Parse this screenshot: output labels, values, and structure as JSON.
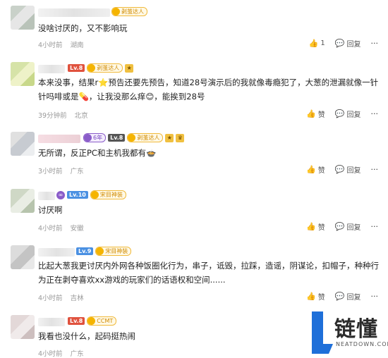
{
  "comments": [
    {
      "badge_medal": "剥茧达人",
      "text_lines": [
        "没啥讨厌的，又不影响玩"
      ],
      "time": "4小时前",
      "location": "湖南",
      "like_label": "1",
      "reply_label": "回复"
    },
    {
      "level": "Lv.8",
      "badge_medal": "剥茧达人",
      "text_lines": [
        "本来没事，结果r⭐预告还要先预告，知道28号演示后的我就像毒瘾犯了，大葱的泄漏就像一针",
        "针吗啡或是💊，让我没那么痒😊，能挨到28号"
      ],
      "time": "39分钟前",
      "location": "北京",
      "like_label": "赞",
      "reply_label": "回复"
    },
    {
      "years": "6年",
      "level": "Lv.8",
      "badge_medal": "剥茧达人",
      "text_lines": [
        "无所谓，反正PC和主机我都有🍲"
      ],
      "time": "3小时前",
      "location": "广东",
      "like_label": "赞",
      "reply_label": "回复"
    },
    {
      "level": "Lv.10",
      "badge_medal": "宋目神装",
      "text_lines": [
        "讨厌啊"
      ],
      "time": "4小时前",
      "location": "安徽",
      "like_label": "赞",
      "reply_label": "回复"
    },
    {
      "level": "Lv.9",
      "badge_medal": "宋目神装",
      "text_lines": [
        "比起大葱我更讨厌内外网各种饭圈化行为，串子，诋毁，拉踩，造谣，阴谋论，扣帽子，种种行",
        "为正在剥夺喜欢xx游戏的玩家们的话语权和空间......"
      ],
      "time": "4小时前",
      "location": "吉林",
      "like_label": "赞",
      "reply_label": "回复"
    },
    {
      "level": "Lv.8",
      "badge_medal": "CCMT",
      "text_lines": [
        "我看也没什么，起码挺热闹"
      ],
      "time": "4小时前",
      "location": "广东"
    }
  ],
  "watermark": {
    "brand": "链懂",
    "domain": "NEATDOWN.COM"
  },
  "colors": {
    "meta": "#999999",
    "medal": "#f0b93a",
    "level_red": "#e0523e"
  }
}
